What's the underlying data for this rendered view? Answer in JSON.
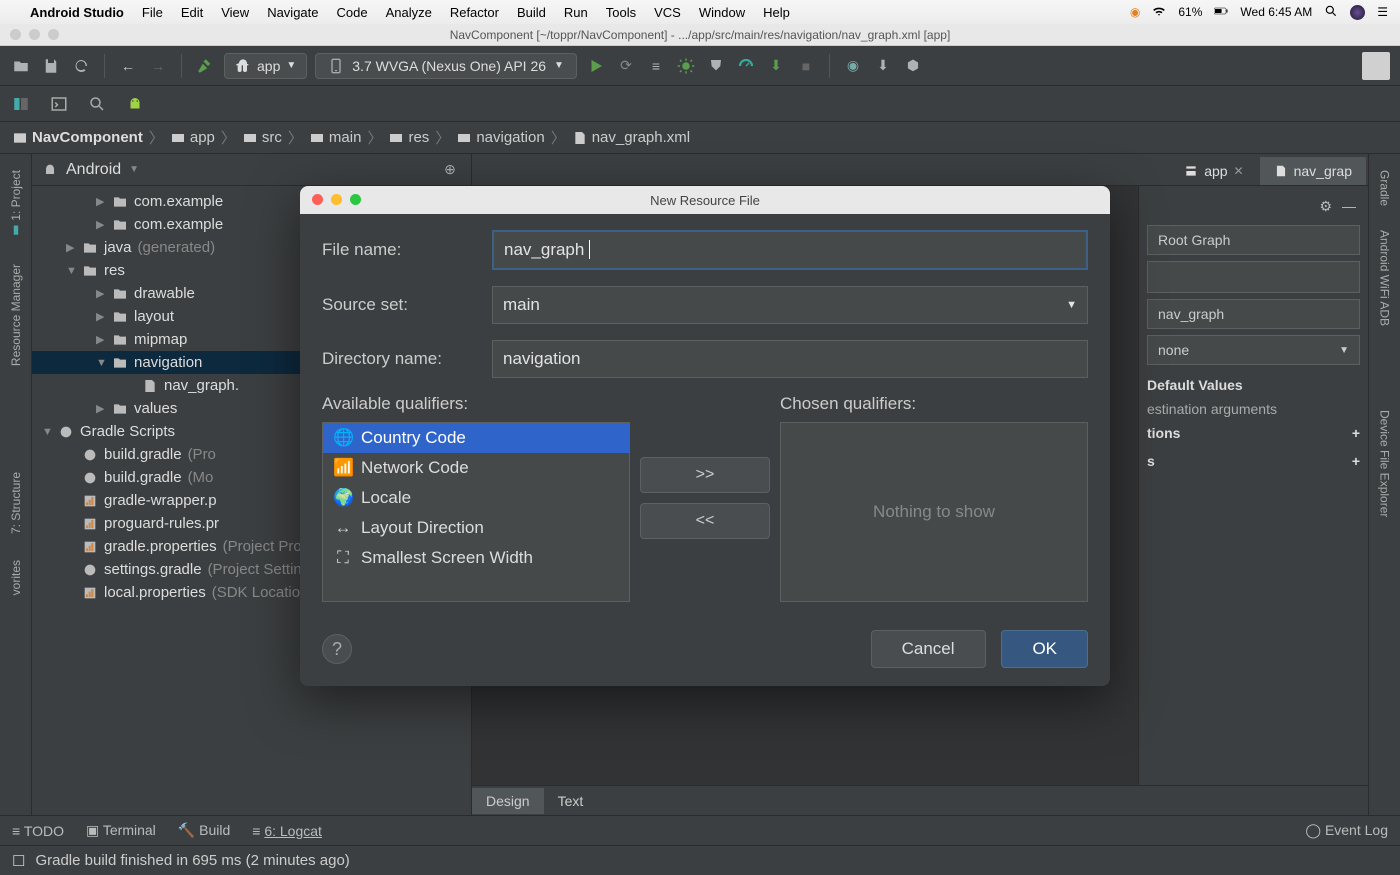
{
  "macbar": {
    "app": "Android Studio",
    "menus": [
      "File",
      "Edit",
      "View",
      "Navigate",
      "Code",
      "Analyze",
      "Refactor",
      "Build",
      "Run",
      "Tools",
      "VCS",
      "Window",
      "Help"
    ],
    "battery": "61%",
    "clock": "Wed 6:45 AM"
  },
  "window_title": "NavComponent [~/toppr/NavComponent] - .../app/src/main/res/navigation/nav_graph.xml [app]",
  "toolbar": {
    "run_config": "app",
    "device": "3.7  WVGA (Nexus One) API 26"
  },
  "breadcrumb": [
    "NavComponent",
    "app",
    "src",
    "main",
    "res",
    "navigation",
    "nav_graph.xml"
  ],
  "project": {
    "view": "Android",
    "tree": [
      {
        "label": "com.example",
        "indent": 2,
        "arrow": "▶",
        "folder": true
      },
      {
        "label": "com.example",
        "indent": 2,
        "arrow": "▶",
        "folder": true
      },
      {
        "label": "java",
        "dim": "(generated)",
        "indent": 1,
        "arrow": "▶",
        "folder": true,
        "cyan": true
      },
      {
        "label": "res",
        "indent": 1,
        "arrow": "▼",
        "folder": true
      },
      {
        "label": "drawable",
        "indent": 2,
        "arrow": "▶",
        "folder": true
      },
      {
        "label": "layout",
        "indent": 2,
        "arrow": "▶",
        "folder": true
      },
      {
        "label": "mipmap",
        "indent": 2,
        "arrow": "▶",
        "folder": true
      },
      {
        "label": "navigation",
        "indent": 2,
        "arrow": "▼",
        "folder": true,
        "sel": true
      },
      {
        "label": "nav_graph.",
        "indent": 3,
        "arrow": "",
        "xml": true
      },
      {
        "label": "values",
        "indent": 2,
        "arrow": "▶",
        "folder": true
      },
      {
        "label": "Gradle Scripts",
        "indent": 0,
        "arrow": "▼",
        "gradle": true
      },
      {
        "label": "build.gradle",
        "dim": "(Pro",
        "indent": 1,
        "gradle": true
      },
      {
        "label": "build.gradle",
        "dim": "(Mo",
        "indent": 1,
        "gradle": true
      },
      {
        "label": "gradle-wrapper.p",
        "indent": 1,
        "props": true
      },
      {
        "label": "proguard-rules.pr",
        "indent": 1,
        "props": true
      },
      {
        "label": "gradle.properties",
        "dim": "(Project Propert",
        "indent": 1,
        "props": true
      },
      {
        "label": "settings.gradle",
        "dim": "(Project Settings)",
        "indent": 1,
        "gradle": true
      },
      {
        "label": "local.properties",
        "dim": "(SDK Location)",
        "indent": 1,
        "props": true
      }
    ]
  },
  "tabs": {
    "open": [
      {
        "label": "app",
        "close": true
      },
      {
        "label": "nav_grap"
      }
    ]
  },
  "attributes": {
    "root_graph": "Root Graph",
    "id_field": "",
    "name_field": "nav_graph",
    "start_dest": "none",
    "default_values": "Default Values",
    "dest_args": "estination arguments",
    "sections": [
      "tions",
      "s"
    ]
  },
  "design_tabs": [
    "Design",
    "Text"
  ],
  "left_gutter": [
    "1: Project",
    "Resource Manager",
    "7: Structure",
    "vorites"
  ],
  "right_gutter": [
    "Gradle",
    "Android WiFi ADB",
    "Device File Explorer"
  ],
  "bottom": {
    "items": [
      "TODO",
      "Terminal",
      "Build",
      "6: Logcat"
    ],
    "event": "Event Log"
  },
  "status": "Gradle build finished in 695 ms (2 minutes ago)",
  "modal": {
    "title": "New Resource File",
    "file_name_label": "File name:",
    "file_name": "nav_graph",
    "source_set_label": "Source set:",
    "source_set": "main",
    "dir_label": "Directory name:",
    "dir": "navigation",
    "avail_label": "Available qualifiers:",
    "chosen_label": "Chosen qualifiers:",
    "qualifiers": [
      "Country Code",
      "Network Code",
      "Locale",
      "Layout Direction",
      "Smallest Screen Width"
    ],
    "chosen_empty": "Nothing to show",
    "add_btn": ">>",
    "remove_btn": "<<",
    "cancel": "Cancel",
    "ok": "OK"
  }
}
